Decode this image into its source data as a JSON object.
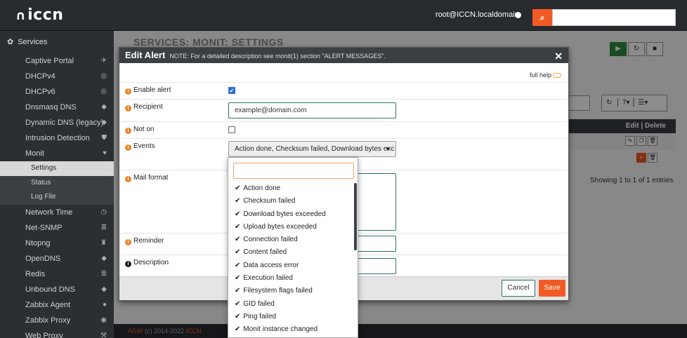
{
  "topbar": {
    "logo": "iccn",
    "user": "root@ICCN.localdomain",
    "search_placeholder": ""
  },
  "sidebar": {
    "section": "Services",
    "items_before": [
      {
        "label": "Captive Portal",
        "icon": "send-icon",
        "glyph": "✈"
      },
      {
        "label": "DHCPv4",
        "icon": "target-icon",
        "glyph": "◎"
      },
      {
        "label": "DHCPv6",
        "icon": "target-icon",
        "glyph": "◎"
      },
      {
        "label": "Dnsmasq DNS",
        "icon": "tag-icon",
        "glyph": "◆"
      },
      {
        "label": "Dynamic DNS (legacy)",
        "icon": "tag-icon",
        "glyph": "◆"
      },
      {
        "label": "Intrusion Detection",
        "icon": "shield-icon",
        "glyph": "⛊"
      },
      {
        "label": "Monit",
        "icon": "heartbeat-icon",
        "glyph": "♥"
      }
    ],
    "subitems": [
      {
        "label": "Settings",
        "active": true
      },
      {
        "label": "Status",
        "active": false
      },
      {
        "label": "Log File",
        "active": false
      }
    ],
    "items_after": [
      {
        "label": "Network Time",
        "icon": "clock-icon",
        "glyph": "◷"
      },
      {
        "label": "Net-SNMP",
        "icon": "server-icon",
        "glyph": "≣"
      },
      {
        "label": "Ntopng",
        "icon": "binoculars-icon",
        "glyph": "♜"
      },
      {
        "label": "OpenDNS",
        "icon": "tag-icon",
        "glyph": "◆"
      },
      {
        "label": "Redis",
        "icon": "database-icon",
        "glyph": "≣"
      },
      {
        "label": "Unbound DNS",
        "icon": "tag-icon",
        "glyph": "◆"
      },
      {
        "label": "Zabbix Agent",
        "icon": "circle-icon",
        "glyph": "●"
      },
      {
        "label": "Zabbix Proxy",
        "icon": "eye-icon",
        "glyph": "◉"
      },
      {
        "label": "Web Proxy",
        "icon": "wrench-icon",
        "glyph": "⚒"
      }
    ]
  },
  "background": {
    "page_title": "SERVICES: MONIT: SETTINGS",
    "table_header": "Edit | Delete",
    "showing": "Showing 1 to 1 of 1 entries",
    "rows_per_page": "7",
    "footer_brand": "AGW",
    "footer_text": " (c) 2014-2022 ",
    "footer_brand2": "ICCN"
  },
  "modal": {
    "title": "Edit Alert",
    "note": "NOTE: For a detailed description see monit(1) section \"ALERT MESSAGES\".",
    "full_help": "full help",
    "fields": {
      "enable_alert": {
        "label": "Enable alert",
        "checked": true
      },
      "recipient": {
        "label": "Recipient",
        "value": "example@domain.com"
      },
      "not_on": {
        "label": "Not on",
        "checked": false
      },
      "events": {
        "label": "Events",
        "value": "Action done, Checksum failed, Download bytes exc"
      },
      "mail_format": {
        "label": "Mail format",
        "value": ""
      },
      "reminder": {
        "label": "Reminder",
        "value": ""
      },
      "description": {
        "label": "Description",
        "value": ""
      }
    },
    "cancel_label": "Cancel",
    "save_label": "Save"
  },
  "events_dropdown": {
    "search_value": "",
    "options": [
      "Action done",
      "Checksum failed",
      "Download bytes exceeded",
      "Upload bytes exceeded",
      "Connection failed",
      "Content failed",
      "Data access error",
      "Execution failed",
      "Filesystem flags failed",
      "GID failed",
      "Ping failed",
      "Monit instance changed"
    ]
  },
  "colors": {
    "accent": "#f15a24",
    "topbar": "#272b30",
    "sidebar": "#2b2f33",
    "checkbox": "#2f6fd6"
  }
}
